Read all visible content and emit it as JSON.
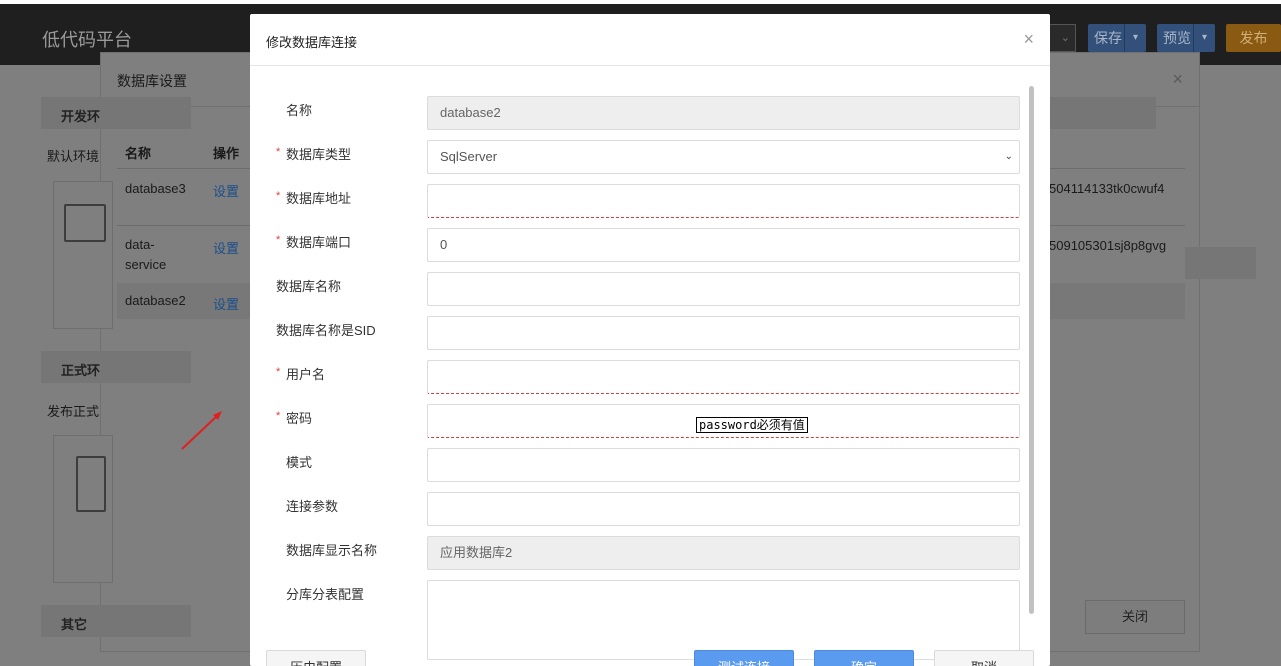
{
  "app": {
    "title": "低代码平台"
  },
  "toolbar": {
    "save_label": "保存",
    "preview_label": "预览",
    "publish_label": "发布",
    "caret": "▾"
  },
  "bg_dialog": {
    "title": "数据库设置",
    "close_icon": "×",
    "sections": {
      "dev": "开发环",
      "default_env": "默认环境",
      "prod": "正式环",
      "publish_prod": "发布正式",
      "other": "其它"
    },
    "table": {
      "headers": [
        "名称",
        "操作"
      ],
      "rows": [
        {
          "name": "database3",
          "action": "设置",
          "id": "504114133tk0cwuf4"
        },
        {
          "name": "data-service",
          "name_line1": "data-",
          "name_line2": "service",
          "action": "设置",
          "id": "509105301sj8p8gvg"
        },
        {
          "name": "database2",
          "action": "设置"
        }
      ]
    },
    "close_button": "关闭"
  },
  "modal": {
    "title": "修改数据库连接",
    "close_icon": "×",
    "fields": {
      "name": {
        "label": "名称",
        "value": "database2"
      },
      "db_type": {
        "label": "数据库类型",
        "value": "SqlServer"
      },
      "db_host": {
        "label": "数据库地址",
        "value": ""
      },
      "db_port": {
        "label": "数据库端口",
        "value": "0"
      },
      "db_name": {
        "label": "数据库名称",
        "value": ""
      },
      "db_name_sid": {
        "label": "数据库名称是SID",
        "value": ""
      },
      "username": {
        "label": "用户名",
        "value": ""
      },
      "password": {
        "label": "密码",
        "value": ""
      },
      "schema": {
        "label": "模式",
        "value": ""
      },
      "conn_params": {
        "label": "连接参数",
        "value": ""
      },
      "display_name": {
        "label": "数据库显示名称",
        "value": "应用数据库2"
      },
      "sharding": {
        "label": "分库分表配置",
        "value": ""
      }
    },
    "required_mark": "*",
    "tooltip": {
      "prefix": "password",
      "message": "必须有值"
    },
    "footer": {
      "history_button": "历史配置",
      "test_button": "测试连接",
      "confirm_button": "确定",
      "cancel_button": "取消"
    }
  },
  "colors": {
    "required": "#e03d3d",
    "primary": "#5a9bef",
    "link": "#1b4e8a",
    "arrow": "#e02020"
  }
}
